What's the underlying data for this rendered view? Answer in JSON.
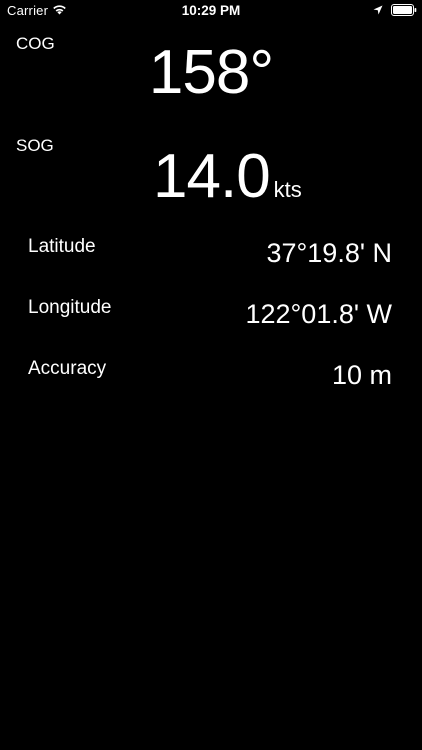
{
  "status_bar": {
    "carrier": "Carrier",
    "time": "10:29 PM",
    "icons": [
      "wifi-icon",
      "location-arrow-icon",
      "battery-icon"
    ]
  },
  "cog": {
    "label": "COG",
    "value": "158°"
  },
  "sog": {
    "label": "SOG",
    "value": "14.0",
    "unit": "kts"
  },
  "position": {
    "latitude_label": "Latitude",
    "latitude_value": "37°19.8' N",
    "longitude_label": "Longitude",
    "longitude_value": "122°01.8' W",
    "accuracy_label": "Accuracy",
    "accuracy_value": "10 m"
  },
  "colors": {
    "background": "#000000",
    "text": "#ffffff"
  }
}
